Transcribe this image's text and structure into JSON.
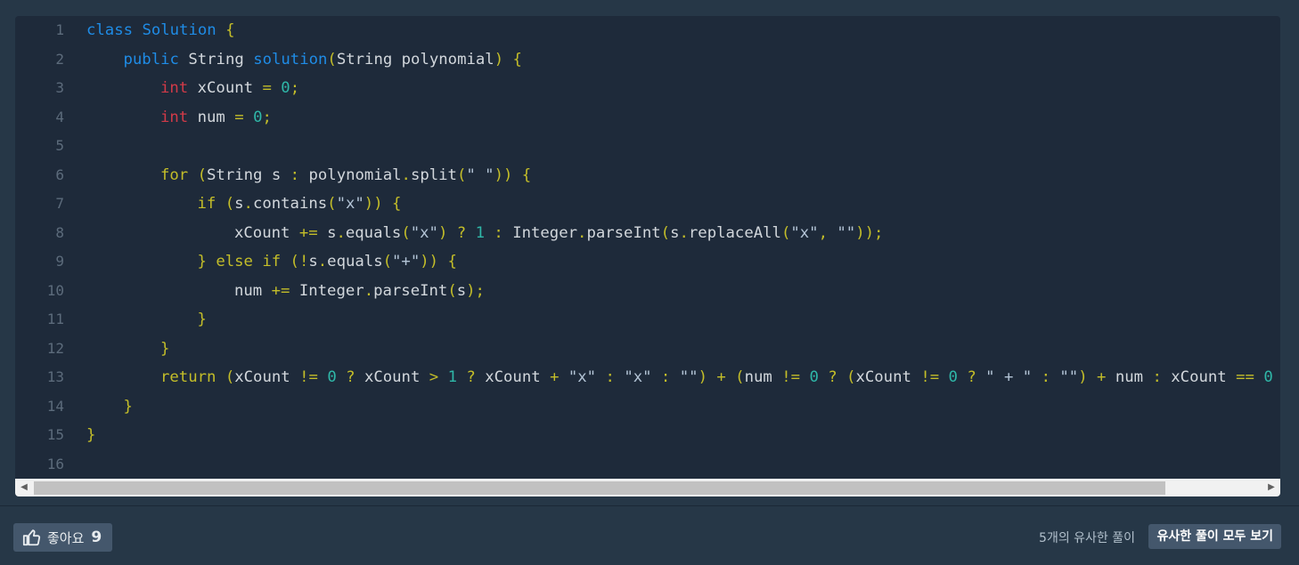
{
  "code": {
    "lines": [
      {
        "n": "1",
        "indent": 0,
        "tokens": [
          [
            "key",
            "class "
          ],
          [
            "key",
            "Solution"
          ],
          [
            "op",
            " {"
          ]
        ]
      },
      {
        "n": "2",
        "indent": 1,
        "tokens": [
          [
            "key",
            "public "
          ],
          [
            "plain",
            "String "
          ],
          [
            "key",
            "solution"
          ],
          [
            "op",
            "("
          ],
          [
            "plain",
            "String polynomial"
          ],
          [
            "op",
            ") {"
          ]
        ]
      },
      {
        "n": "3",
        "indent": 2,
        "tokens": [
          [
            "type",
            "int "
          ],
          [
            "plain",
            "xCount "
          ],
          [
            "op",
            "= "
          ],
          [
            "num",
            "0"
          ],
          [
            "op",
            ";"
          ]
        ]
      },
      {
        "n": "4",
        "indent": 2,
        "tokens": [
          [
            "type",
            "int "
          ],
          [
            "plain",
            "num "
          ],
          [
            "op",
            "= "
          ],
          [
            "num",
            "0"
          ],
          [
            "op",
            ";"
          ]
        ]
      },
      {
        "n": "5",
        "indent": 0,
        "tokens": []
      },
      {
        "n": "6",
        "indent": 2,
        "tokens": [
          [
            "kw2",
            "for "
          ],
          [
            "op",
            "("
          ],
          [
            "plain",
            "String s "
          ],
          [
            "op",
            ": "
          ],
          [
            "plain",
            "polynomial"
          ],
          [
            "op",
            "."
          ],
          [
            "plain",
            "split"
          ],
          [
            "op",
            "("
          ],
          [
            "str",
            "\" \""
          ],
          [
            "op",
            ")) {"
          ]
        ]
      },
      {
        "n": "7",
        "indent": 3,
        "tokens": [
          [
            "kw2",
            "if "
          ],
          [
            "op",
            "("
          ],
          [
            "plain",
            "s"
          ],
          [
            "op",
            "."
          ],
          [
            "plain",
            "contains"
          ],
          [
            "op",
            "("
          ],
          [
            "str",
            "\"x\""
          ],
          [
            "op",
            ")) {"
          ]
        ]
      },
      {
        "n": "8",
        "indent": 4,
        "tokens": [
          [
            "plain",
            "xCount "
          ],
          [
            "op",
            "+= "
          ],
          [
            "plain",
            "s"
          ],
          [
            "op",
            "."
          ],
          [
            "plain",
            "equals"
          ],
          [
            "op",
            "("
          ],
          [
            "str",
            "\"x\""
          ],
          [
            "op",
            ") ? "
          ],
          [
            "num",
            "1"
          ],
          [
            "op",
            " : "
          ],
          [
            "plain",
            "Integer"
          ],
          [
            "op",
            "."
          ],
          [
            "plain",
            "parseInt"
          ],
          [
            "op",
            "("
          ],
          [
            "plain",
            "s"
          ],
          [
            "op",
            "."
          ],
          [
            "plain",
            "replaceAll"
          ],
          [
            "op",
            "("
          ],
          [
            "str",
            "\"x\""
          ],
          [
            "op",
            ", "
          ],
          [
            "str",
            "\"\""
          ],
          [
            "op",
            "));"
          ]
        ]
      },
      {
        "n": "9",
        "indent": 3,
        "tokens": [
          [
            "op",
            "} "
          ],
          [
            "kw2",
            "else if "
          ],
          [
            "op",
            "(!"
          ],
          [
            "plain",
            "s"
          ],
          [
            "op",
            "."
          ],
          [
            "plain",
            "equals"
          ],
          [
            "op",
            "("
          ],
          [
            "str",
            "\"+\""
          ],
          [
            "op",
            ")) {"
          ]
        ]
      },
      {
        "n": "10",
        "indent": 4,
        "tokens": [
          [
            "plain",
            "num "
          ],
          [
            "op",
            "+= "
          ],
          [
            "plain",
            "Integer"
          ],
          [
            "op",
            "."
          ],
          [
            "plain",
            "parseInt"
          ],
          [
            "op",
            "("
          ],
          [
            "plain",
            "s"
          ],
          [
            "op",
            ");"
          ]
        ]
      },
      {
        "n": "11",
        "indent": 3,
        "tokens": [
          [
            "op",
            "}"
          ]
        ]
      },
      {
        "n": "12",
        "indent": 2,
        "tokens": [
          [
            "op",
            "}"
          ]
        ]
      },
      {
        "n": "13",
        "indent": 2,
        "tokens": [
          [
            "kw2",
            "return "
          ],
          [
            "op",
            "("
          ],
          [
            "plain",
            "xCount "
          ],
          [
            "op",
            "!= "
          ],
          [
            "num",
            "0"
          ],
          [
            "op",
            " ? "
          ],
          [
            "plain",
            "xCount "
          ],
          [
            "op",
            "> "
          ],
          [
            "num",
            "1"
          ],
          [
            "op",
            " ? "
          ],
          [
            "plain",
            "xCount "
          ],
          [
            "op",
            "+ "
          ],
          [
            "str",
            "\"x\""
          ],
          [
            "op",
            " : "
          ],
          [
            "str",
            "\"x\""
          ],
          [
            "op",
            " : "
          ],
          [
            "str",
            "\"\""
          ],
          [
            "op",
            ") + ("
          ],
          [
            "plain",
            "num "
          ],
          [
            "op",
            "!= "
          ],
          [
            "num",
            "0"
          ],
          [
            "op",
            " ? ("
          ],
          [
            "plain",
            "xCount "
          ],
          [
            "op",
            "!= "
          ],
          [
            "num",
            "0"
          ],
          [
            "op",
            " ? "
          ],
          [
            "str",
            "\" + \""
          ],
          [
            "op",
            " : "
          ],
          [
            "str",
            "\"\""
          ],
          [
            "op",
            ") + "
          ],
          [
            "plain",
            "num "
          ],
          [
            "op",
            ": "
          ],
          [
            "plain",
            "xCount "
          ],
          [
            "op",
            "== "
          ],
          [
            "num",
            "0"
          ],
          [
            "op",
            " ? "
          ]
        ]
      },
      {
        "n": "14",
        "indent": 1,
        "tokens": [
          [
            "op",
            "}"
          ]
        ]
      },
      {
        "n": "15",
        "indent": 0,
        "tokens": [
          [
            "op",
            "}"
          ]
        ]
      },
      {
        "n": "16",
        "indent": 0,
        "tokens": []
      }
    ]
  },
  "footer": {
    "like_label": "좋아요",
    "like_count": "9",
    "similar_count_text": "5개의 유사한 풀이",
    "similar_button_label": "유사한 풀이 모두 보기"
  },
  "colors": {
    "background": "#263747",
    "code_background": "#1e2a3a",
    "keyword": "#1f8ce6",
    "control": "#c4be29",
    "type": "#d03a48",
    "number": "#2fb7a8"
  },
  "icons": {
    "like": "thumbs-up-icon",
    "scroll_left": "triangle-left-icon",
    "scroll_right": "triangle-right-icon"
  }
}
